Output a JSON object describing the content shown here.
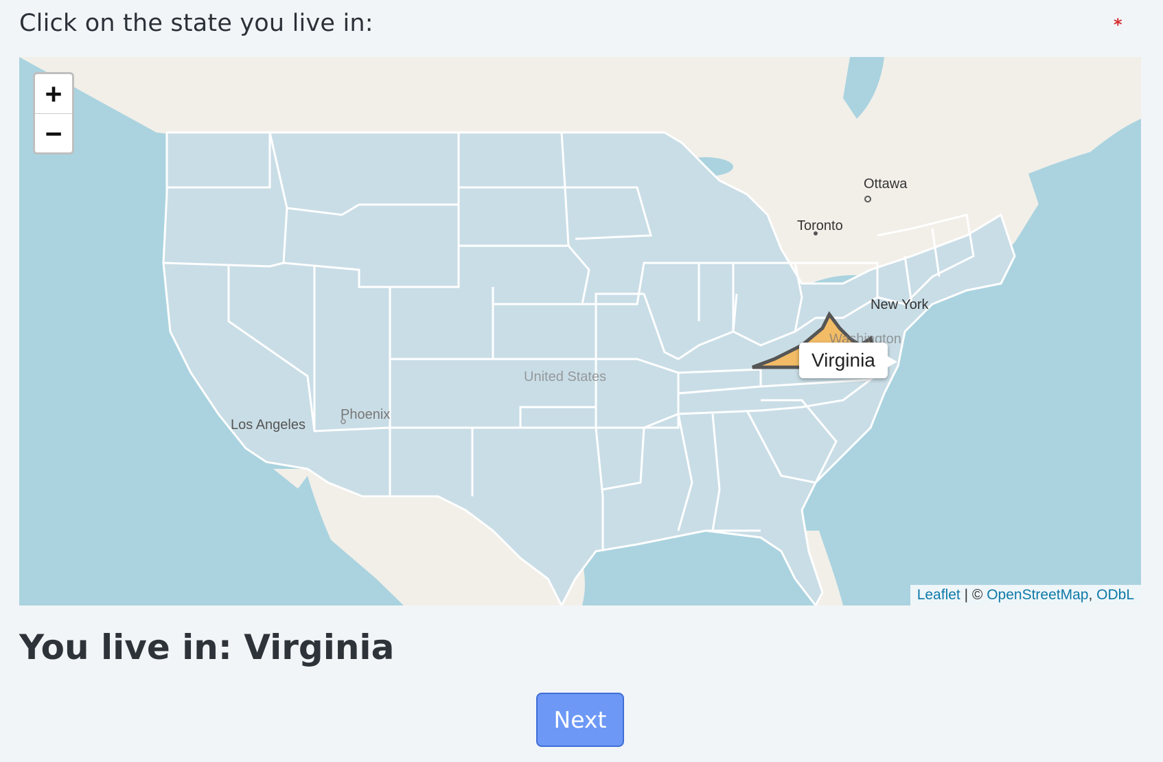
{
  "question": {
    "text": "Click on the state you live in:",
    "required_marker": "*"
  },
  "map": {
    "zoom_in_label": "+",
    "zoom_out_label": "−",
    "hovered_state": "Virginia",
    "city_labels": {
      "ottawa": "Ottawa",
      "toronto": "Toronto",
      "new_york": "New York",
      "washington": "Washington",
      "united_states": "United States",
      "phoenix": "Phoenix",
      "los_angeles": "Los Angeles"
    },
    "attribution": {
      "leaflet": "Leaflet",
      "separator": " | © ",
      "osm": "OpenStreetMap",
      "comma": ", ",
      "odbl": "ODbL"
    },
    "colors": {
      "water": "#aad3df",
      "land": "#f2efe9",
      "state_fill": "#c9dde6",
      "state_border": "#ffffff",
      "selected_fill": "#f2bc66",
      "selected_border": "#555555"
    }
  },
  "result": {
    "text": "You live in: Virginia"
  },
  "next_button": {
    "label": "Next"
  }
}
